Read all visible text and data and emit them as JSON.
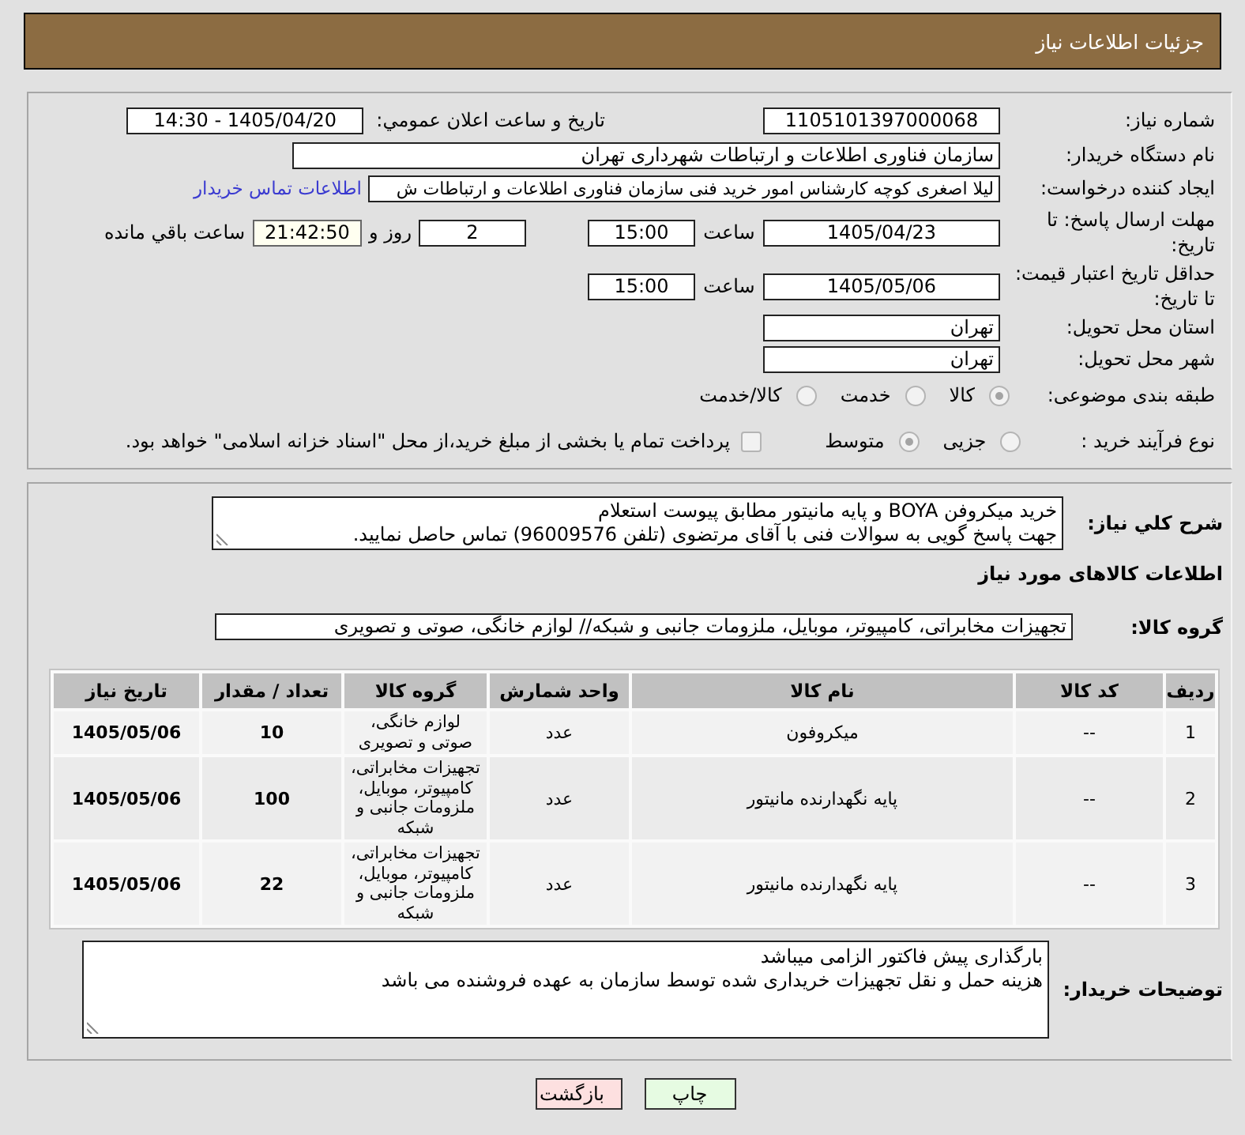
{
  "header": {
    "title": "جزئیات اطلاعات نیاز"
  },
  "details": {
    "need_number": {
      "label": "شماره نیاز:",
      "value": "1105101397000068"
    },
    "announcement": {
      "label": "تاریخ و ساعت اعلان عمومي:",
      "value": "1405/04/20 - 14:30"
    },
    "buyer_org": {
      "label": "نام دستگاه خریدار:",
      "value": "سازمان فناوری اطلاعات و ارتباطات شهرداری تهران"
    },
    "requester": {
      "label": "ایجاد کننده درخواست:",
      "value": "لیلا اصغری کوچه کارشناس امور خرید فنی سازمان فناوری اطلاعات و ارتباطات ش",
      "contact_link": "اطلاعات تماس خریدار"
    },
    "reply_deadline": {
      "label": "مهلت ارسال پاسخ: تا تاریخ:",
      "date": "1405/04/23",
      "time_label": "ساعت",
      "time": "15:00",
      "days": "2",
      "days_label": "روز و",
      "remaining": "21:42:50",
      "remaining_label": "ساعت باقي مانده"
    },
    "price_validity": {
      "label": "حداقل تاریخ اعتبار قیمت: تا تاریخ:",
      "date": "1405/05/06",
      "time_label": "ساعت",
      "time": "15:00"
    },
    "province": {
      "label": "استان محل تحویل:",
      "value": "تهران"
    },
    "city": {
      "label": "شهر محل تحویل:",
      "value": "تهران"
    },
    "category": {
      "label": "طبقه بندی موضوعی:",
      "options": [
        {
          "label": "کالا",
          "selected": true
        },
        {
          "label": "خدمت",
          "selected": false
        },
        {
          "label": "کالا/خدمت",
          "selected": false
        }
      ]
    },
    "purchase_type": {
      "label": "نوع فرآیند خرید :",
      "options": [
        {
          "label": "جزیی",
          "selected": false
        },
        {
          "label": "متوسط",
          "selected": true
        }
      ],
      "treasury": {
        "label": "پرداخت تمام یا بخشی از مبلغ خرید،از محل \"اسناد خزانه اسلامی\" خواهد بود.",
        "checked": false
      }
    }
  },
  "description": {
    "label": "شرح کلي نیاز:",
    "lines": [
      "خرید میکروفن BOYA و پایه مانیتور مطابق پیوست استعلام",
      "جهت پاسخ گویی به سوالات فنی با آقای مرتضوی (تلفن 96009576) تماس حاصل نمایید."
    ]
  },
  "items": {
    "title": "اطلاعات کالاهای مورد نیاز",
    "group_label": "گروه کالا:",
    "group_value": "تجهیزات مخابراتی، کامپیوتر، موبایل، ملزومات جانبی و شبکه// لوازم خانگی، صوتی و تصویری",
    "table": {
      "columns": [
        "ردیف",
        "کد کالا",
        "نام کالا",
        "واحد شمارش",
        "گروه کالا",
        "تعداد / مقدار",
        "تاریخ نیاز"
      ],
      "rows": [
        {
          "cells": [
            "1",
            "--",
            "میکروفون",
            "عدد",
            "لوازم خانگی، صوتی و تصویری",
            "10",
            "1405/05/06"
          ]
        },
        {
          "cells": [
            "2",
            "--",
            "پایه نگهدارنده مانیتور",
            "عدد",
            "تجهیزات مخابراتی، کامپیوتر، موبایل، ملزومات جانبی و شبکه",
            "100",
            "1405/05/06"
          ]
        },
        {
          "cells": [
            "3",
            "--",
            "پایه نگهدارنده مانیتور",
            "عدد",
            "تجهیزات مخابراتی، کامپیوتر، موبایل، ملزومات جانبی و شبکه",
            "22",
            "1405/05/06"
          ]
        }
      ]
    }
  },
  "buyer_notes": {
    "label": "توضیحات خریدار:",
    "lines": [
      "بارگذاری پیش فاکتور الزامی میباشد",
      "هزینه حمل و نقل تجهیزات خریداری شده توسط سازمان به عهده فروشنده می باشد"
    ]
  },
  "buttons": [
    {
      "label": "چاپ",
      "kind": "print"
    },
    {
      "label": "بازگشت",
      "kind": "back"
    }
  ]
}
